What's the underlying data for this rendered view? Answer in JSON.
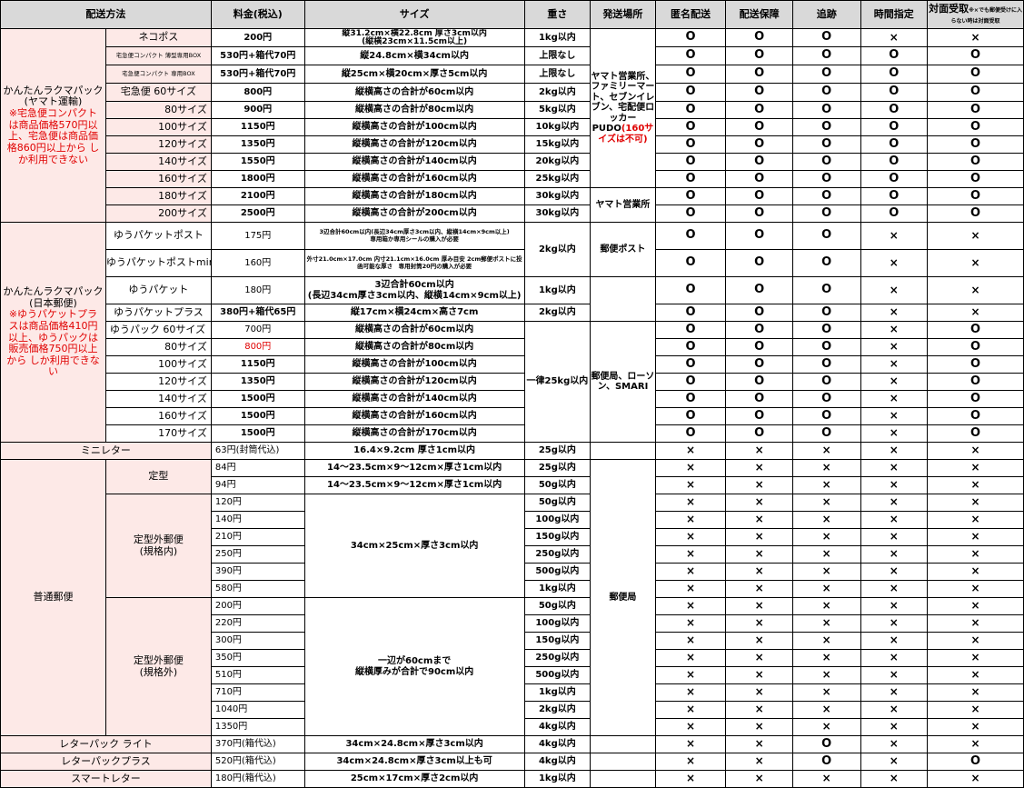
{
  "headers": [
    "配送方法",
    "料金(税込)",
    "サイズ",
    "重さ",
    "発送場所",
    "匿名配送",
    "配送保障",
    "追跡",
    "時間指定",
    "対面受取",
    "※×でも郵便受けに入らない時は対面受取"
  ],
  "marks": {
    "o": "O",
    "x": "×"
  },
  "yamato": {
    "group": [
      "かんたんラクマパック",
      "(ヤマト運輸)"
    ],
    "note": "※宅急便コンパクトは商品価格570円以上、宅急便は商品価格860円以上から しか利用できない",
    "origin_a": [
      "ヤマト営業所、ファミリーマート、セブンイレブン、宅配便ロッカーPUDO",
      "(160サイズは不可)"
    ],
    "origin_b": "ヤマト営業所",
    "rows": [
      {
        "name": "ネコポス",
        "price": "200円",
        "size": "縦31.2cm×横22.8cm 厚さ3cm以内\n(縦横23cm×11.5cm以上)",
        "weight": "1kg以内",
        "m": "ooox x"
      },
      {
        "name": "宅急便コンパクト 薄型専用BOX",
        "price": "530円+箱代70円",
        "size": "縦24.8cm×横34cm以内",
        "weight": "上限なし",
        "m": "ooooo"
      },
      {
        "name": "宅急便コンパクト 専用BOX",
        "price": "530円+箱代70円",
        "size": "縦25cm×横20cm×厚さ5cm以内",
        "weight": "上限なし",
        "m": "ooooo"
      },
      {
        "name": "宅急便 60サイズ",
        "price": "800円",
        "size": "縦横高さの合計が60cm以内",
        "weight": "2kg以内",
        "m": "ooooo"
      },
      {
        "name": "80サイズ",
        "price": "900円",
        "size": "縦横高さの合計が80cm以内",
        "weight": "5kg以内",
        "m": "ooooo"
      },
      {
        "name": "100サイズ",
        "price": "1150円",
        "size": "縦横高さの合計が100cm以内",
        "weight": "10kg以内",
        "m": "ooooo"
      },
      {
        "name": "120サイズ",
        "price": "1350円",
        "size": "縦横高さの合計が120cm以内",
        "weight": "15kg以内",
        "m": "ooooo"
      },
      {
        "name": "140サイズ",
        "price": "1550円",
        "size": "縦横高さの合計が140cm以内",
        "weight": "20kg以内",
        "m": "ooooo"
      },
      {
        "name": "160サイズ",
        "price": "1800円",
        "size": "縦横高さの合計が160cm以内",
        "weight": "25kg以内",
        "m": "ooooo"
      },
      {
        "name": "180サイズ",
        "price": "2100円",
        "size": "縦横高さの合計が180cm以内",
        "weight": "30kg以内",
        "m": "ooooo"
      },
      {
        "name": "200サイズ",
        "price": "2500円",
        "size": "縦横高さの合計が200cm以内",
        "weight": "30kg以内",
        "m": "ooooo"
      }
    ]
  },
  "yubin": {
    "group": [
      "かんたんラクマパック",
      "(日本郵便)"
    ],
    "note": "※ゆうパケットプラスは商品価格410円以上、ゆうパックは販売価格750円以上から しか利用できない",
    "post_weight": "2kg以内",
    "post_origin": "郵便ポスト",
    "pack_weight": "一律25kg以内",
    "pack_origin": "郵便局、ローソン、SMARI",
    "rows": [
      {
        "name": "ゆうパケットポスト",
        "price": "175円",
        "size": "3辺合計60cm以内(長辺34cm厚さ3cm以内、縦横14cm×9cm以上)\n専用箱か専用シールの購入が必要",
        "weight": "",
        "m": "oooxx"
      },
      {
        "name": "ゆうパケットポストmini",
        "price": "160円",
        "size": "外寸21.0cm×17.0cm 内寸21.1cm×16.0cm 厚み目安 2cm郵便ポストに投函可能な厚さ　専用封筒20円の購入が必要",
        "weight": "",
        "m": "oooxx"
      },
      {
        "name": "ゆうパケット",
        "price": "180円",
        "size": "3辺合計60cm以内\n(長辺34cm厚さ3cm以内、縦横14cm×9cm以上)",
        "weight": "1kg以内",
        "m": "oooxx"
      },
      {
        "name": "ゆうパケットプラス",
        "price": "380円+箱代65円",
        "size": "縦17cm×横24cm×高さ7cm",
        "weight": "2kg以内",
        "m": "oooxx"
      },
      {
        "name": "ゆうパック 60サイズ",
        "price": "700円",
        "size": "縦横高さの合計が60cm以内",
        "weight": "",
        "m": "oooxo"
      },
      {
        "name": "80サイズ",
        "price": "800円",
        "size": "縦横高さの合計が80cm以内",
        "weight": "",
        "m": "oooxo"
      },
      {
        "name": "100サイズ",
        "price": "1150円",
        "size": "縦横高さの合計が100cm以内",
        "weight": "",
        "m": "oooxo"
      },
      {
        "name": "120サイズ",
        "price": "1350円",
        "size": "縦横高さの合計が120cm以内",
        "weight": "",
        "m": "oooxo"
      },
      {
        "name": "140サイズ",
        "price": "1500円",
        "size": "縦横高さの合計が140cm以内",
        "weight": "",
        "m": "oooxo"
      },
      {
        "name": "160サイズ",
        "price": "1500円",
        "size": "縦横高さの合計が160cm以内",
        "weight": "",
        "m": "oooxo"
      },
      {
        "name": "170サイズ",
        "price": "1500円",
        "size": "縦横高さの合計が170cm以内",
        "weight": "",
        "m": "oooxo"
      }
    ]
  },
  "minileter": {
    "name": "ミニレター",
    "price": "63円(封筒代込)",
    "size": "16.4×9.2cm 厚さ1cm以内",
    "weight": "25g以内"
  },
  "futsu": {
    "group": "普通郵便",
    "origin": "郵便局",
    "teikei": {
      "name": "定型",
      "size": "14～23.5cm×9～12cm×厚さ1cm以内",
      "rows": [
        {
          "price": "84円",
          "weight": "25g以内"
        },
        {
          "price": "94円",
          "weight": "50g以内"
        }
      ]
    },
    "naikaku": {
      "name": [
        "定型外郵便",
        "(規格内)"
      ],
      "size": "34cm×25cm×厚さ3cm以内",
      "rows": [
        {
          "price": "120円",
          "weight": "50g以内"
        },
        {
          "price": "140円",
          "weight": "100g以内"
        },
        {
          "price": "210円",
          "weight": "150g以内"
        },
        {
          "price": "250円",
          "weight": "250g以内"
        },
        {
          "price": "390円",
          "weight": "500g以内"
        },
        {
          "price": "580円",
          "weight": "1kg以内"
        }
      ]
    },
    "gaikaku": {
      "name": [
        "定型外郵便",
        "(規格外)"
      ],
      "size": [
        "一辺が60cmまで",
        "縦横厚みが合計で90cm以内"
      ],
      "rows": [
        {
          "price": "200円",
          "weight": "50g以内"
        },
        {
          "price": "220円",
          "weight": "100g以内"
        },
        {
          "price": "300円",
          "weight": "150g以内"
        },
        {
          "price": "350円",
          "weight": "250g以内"
        },
        {
          "price": "510円",
          "weight": "500g以内"
        },
        {
          "price": "710円",
          "weight": "1kg以内"
        },
        {
          "price": "1040円",
          "weight": "2kg以内"
        },
        {
          "price": "1350円",
          "weight": "4kg以内"
        }
      ]
    }
  },
  "letterpack": [
    {
      "name": "レターパック ライト",
      "price": "370円(箱代込)",
      "size": "34cm×24.8cm×厚さ3cm以内",
      "weight": "4kg以内",
      "m": "xxoxx"
    },
    {
      "name": "レターパックプラス",
      "price": "520円(箱代込)",
      "size": "34cm×24.8cm×厚さ3cm以上も可",
      "weight": "4kg以内",
      "m": "xxoxo"
    },
    {
      "name": "スマートレター",
      "price": "180円(箱代込)",
      "size": "25cm×17cm×厚さ2cm以内",
      "weight": "1kg以内",
      "m": "xxxxx"
    }
  ]
}
